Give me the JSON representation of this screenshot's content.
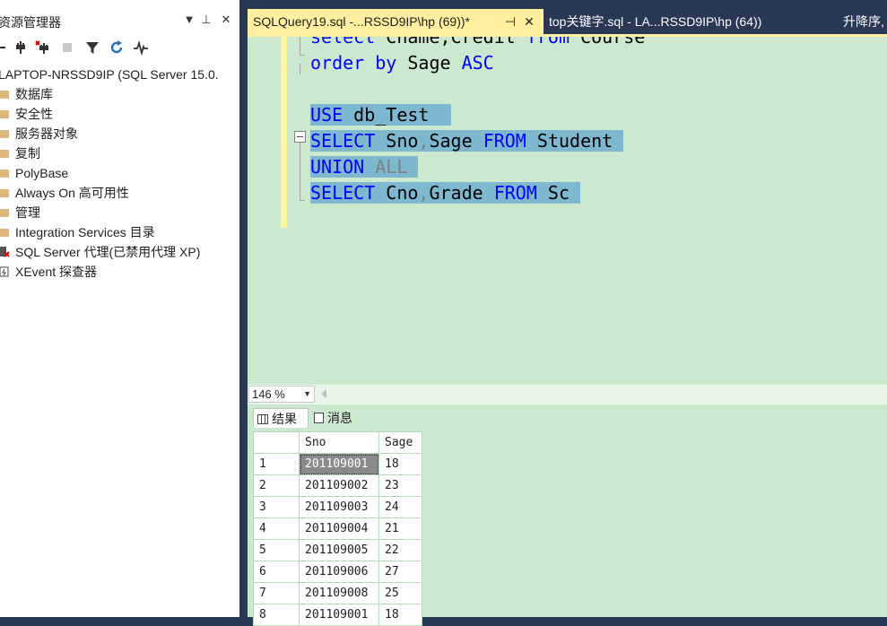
{
  "object_explorer": {
    "title": "资源管理器",
    "title_buttons": [
      "▼",
      "⊥",
      "✕"
    ],
    "server_node": "LAPTOP-NRSSD9IP (SQL Server 15.0.",
    "nodes": [
      {
        "label": "数据库",
        "icon": "folder-icon"
      },
      {
        "label": "安全性",
        "icon": "folder-icon"
      },
      {
        "label": "服务器对象",
        "icon": "folder-icon"
      },
      {
        "label": "复制",
        "icon": "folder-icon"
      },
      {
        "label": "PolyBase",
        "icon": "folder-icon"
      },
      {
        "label": "Always On 高可用性",
        "icon": "folder-icon"
      },
      {
        "label": "管理",
        "icon": "folder-icon"
      },
      {
        "label": "Integration Services 目录",
        "icon": "folder-icon"
      },
      {
        "label": "SQL Server 代理(已禁用代理 XP)",
        "icon": "agent-disabled-icon"
      },
      {
        "label": "XEvent 探查器",
        "icon": "xevent-icon"
      }
    ],
    "toolbar_icons": [
      "connect-icon",
      "disconnect-icon",
      "stop-icon",
      "filter-icon",
      "refresh-icon",
      "activity-monitor-icon"
    ]
  },
  "tabs": {
    "active_label": "SQLQuery19.sql -...RSSD9IP\\hp (69))*",
    "pin_glyph": "⊣",
    "close_glyph": "✕",
    "inactive_label": "top关键字.sql - LA...RSSD9IP\\hp (64))",
    "overflow_label": "升降序,"
  },
  "editor": {
    "lines": [
      {
        "parts": [
          {
            "t": "select",
            "c": "kw"
          },
          {
            "t": " Cname,Credit ",
            "c": ""
          },
          {
            "t": "from",
            "c": "kw"
          },
          {
            "t": " Course",
            "c": ""
          }
        ]
      },
      {
        "parts": [
          {
            "t": "order by",
            "c": "kw"
          },
          {
            "t": " Sage ",
            "c": ""
          },
          {
            "t": "ASC",
            "c": "kw"
          }
        ]
      },
      {
        "parts": []
      },
      {
        "parts": [
          {
            "t": "USE",
            "c": "kw"
          },
          {
            "t": " db_Test  ",
            "c": ""
          }
        ]
      },
      {
        "parts": [
          {
            "t": "SELECT",
            "c": "kw"
          },
          {
            "t": " Sno",
            "c": ""
          },
          {
            "t": ",",
            "c": "gray"
          },
          {
            "t": "Sage ",
            "c": ""
          },
          {
            "t": "FROM",
            "c": "kw"
          },
          {
            "t": " Student ",
            "c": ""
          }
        ]
      },
      {
        "parts": [
          {
            "t": "UNION",
            "c": "kw"
          },
          {
            "t": " ",
            "c": ""
          },
          {
            "t": "ALL",
            "c": "gray"
          },
          {
            "t": " ",
            "c": ""
          }
        ]
      },
      {
        "parts": [
          {
            "t": "SELECT",
            "c": "kw"
          },
          {
            "t": " Cno",
            "c": ""
          },
          {
            "t": ",",
            "c": "gray"
          },
          {
            "t": "Grade ",
            "c": ""
          },
          {
            "t": "FROM",
            "c": "kw"
          },
          {
            "t": " Sc ",
            "c": ""
          }
        ]
      }
    ],
    "selected_from_line": 3
  },
  "zoom": {
    "value": "146 %"
  },
  "results": {
    "tab_results": "结果",
    "tab_messages": "消息",
    "columns": [
      "Sno",
      "Sage"
    ],
    "rows": [
      {
        "n": "1",
        "sno": "201109001",
        "sage": "18"
      },
      {
        "n": "2",
        "sno": "201109002",
        "sage": "23"
      },
      {
        "n": "3",
        "sno": "201109003",
        "sage": "24"
      },
      {
        "n": "4",
        "sno": "201109004",
        "sage": "21"
      },
      {
        "n": "5",
        "sno": "201109005",
        "sage": "22"
      },
      {
        "n": "6",
        "sno": "201109006",
        "sage": "27"
      },
      {
        "n": "7",
        "sno": "201109008",
        "sage": "25"
      },
      {
        "n": "8",
        "sno": "201109001",
        "sage": "18"
      }
    ]
  }
}
